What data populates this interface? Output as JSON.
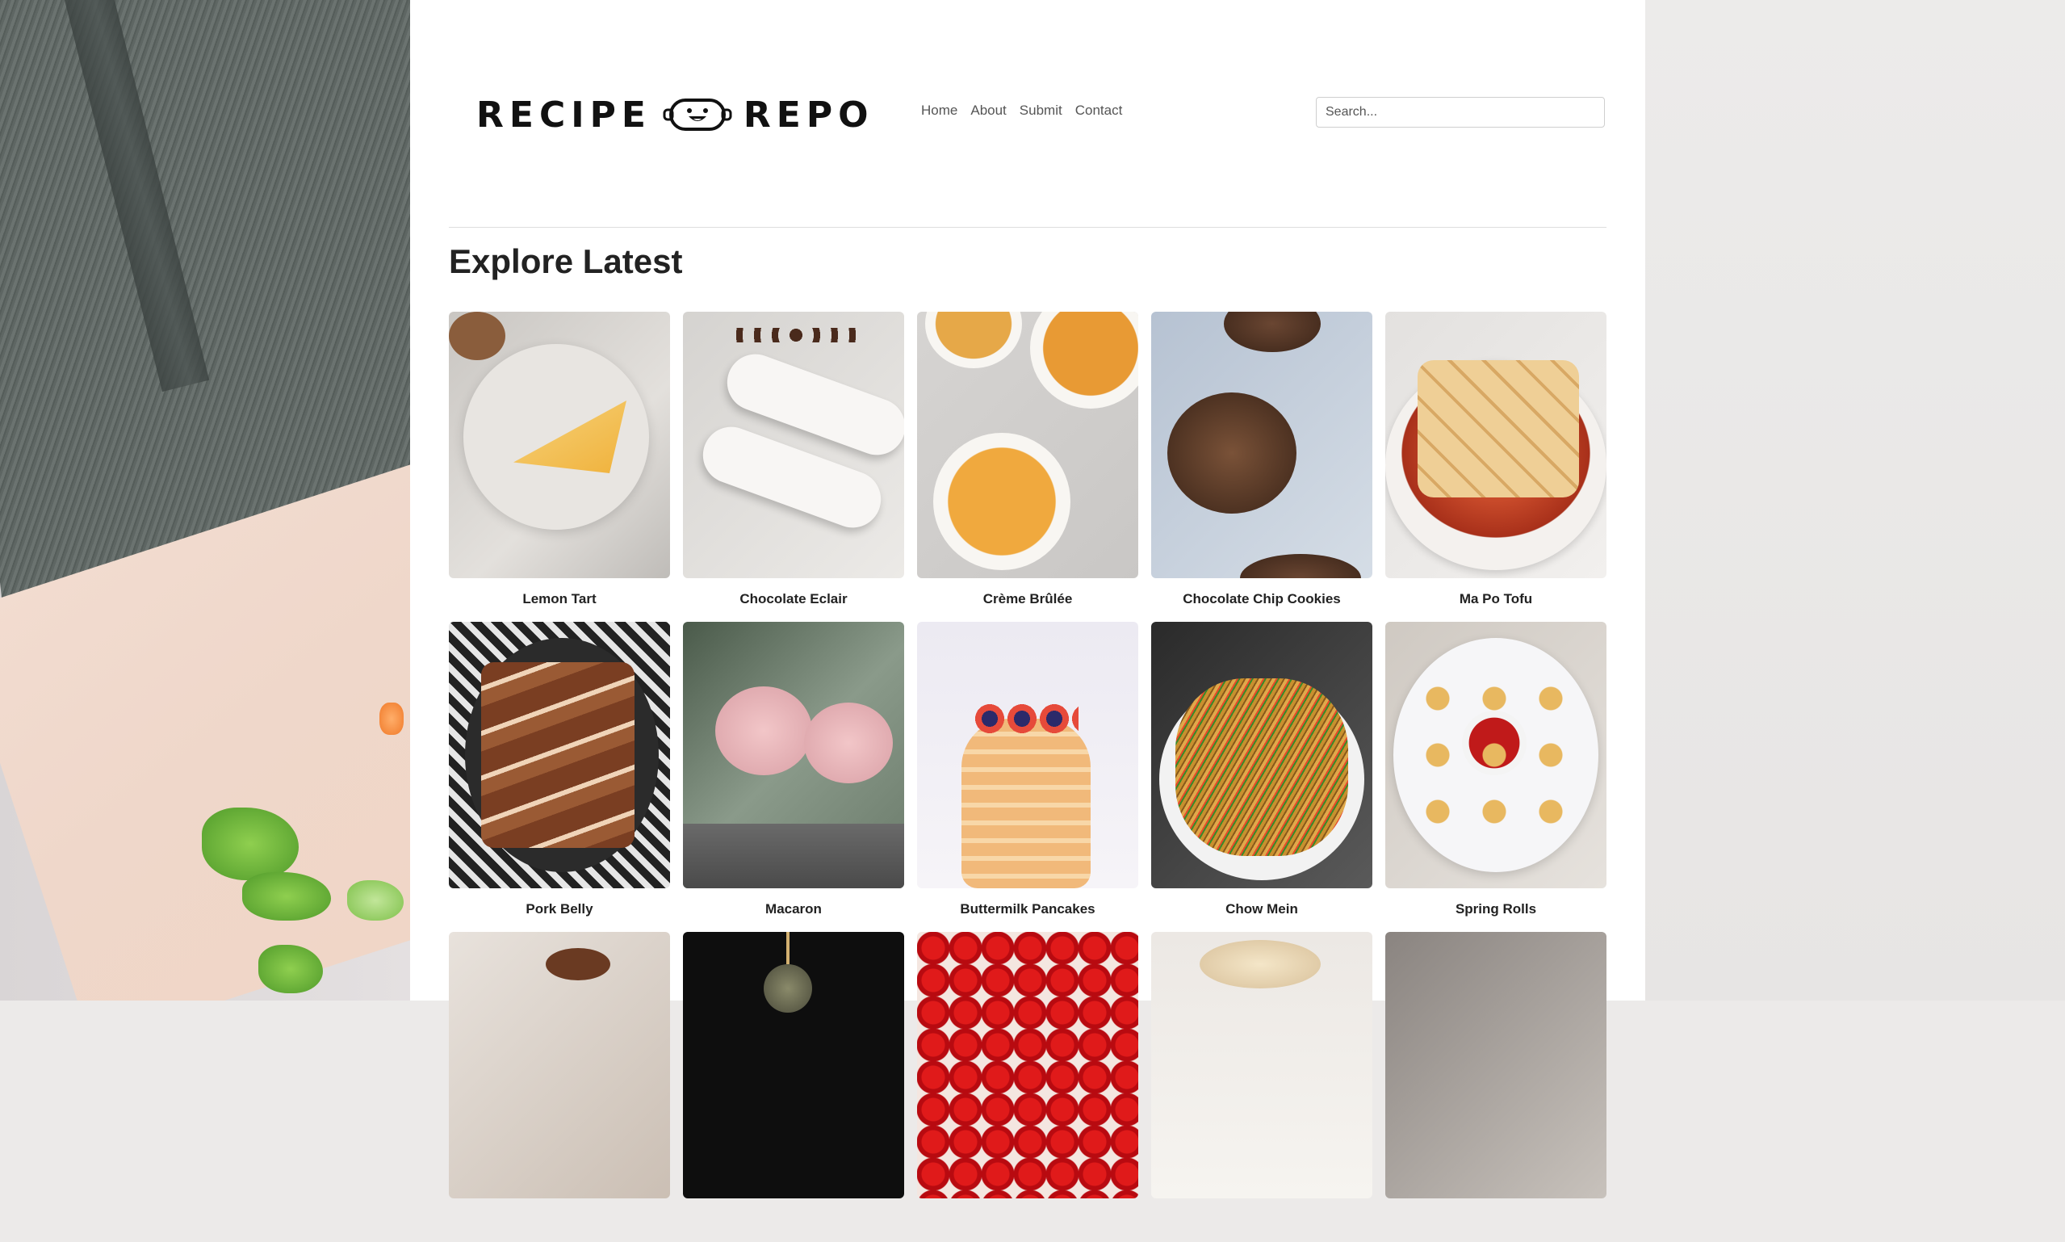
{
  "site": {
    "logo_left": "RECIPE",
    "logo_right": "REPO"
  },
  "nav": {
    "items": [
      "Home",
      "About",
      "Submit",
      "Contact"
    ]
  },
  "search": {
    "placeholder": "Search..."
  },
  "section": {
    "title": "Explore Latest"
  },
  "recipes": [
    {
      "name": "Lemon Tart"
    },
    {
      "name": "Chocolate Eclair"
    },
    {
      "name": "Crème Brûlée"
    },
    {
      "name": "Chocolate Chip Cookies"
    },
    {
      "name": "Ma Po Tofu"
    },
    {
      "name": "Pork Belly"
    },
    {
      "name": "Macaron"
    },
    {
      "name": "Buttermilk Pancakes"
    },
    {
      "name": "Chow Mein"
    },
    {
      "name": "Spring Rolls"
    },
    {
      "name": ""
    },
    {
      "name": ""
    },
    {
      "name": ""
    },
    {
      "name": ""
    },
    {
      "name": ""
    }
  ],
  "colors": {
    "page": "#ffffff",
    "text": "#222222",
    "nav": "#555555"
  }
}
